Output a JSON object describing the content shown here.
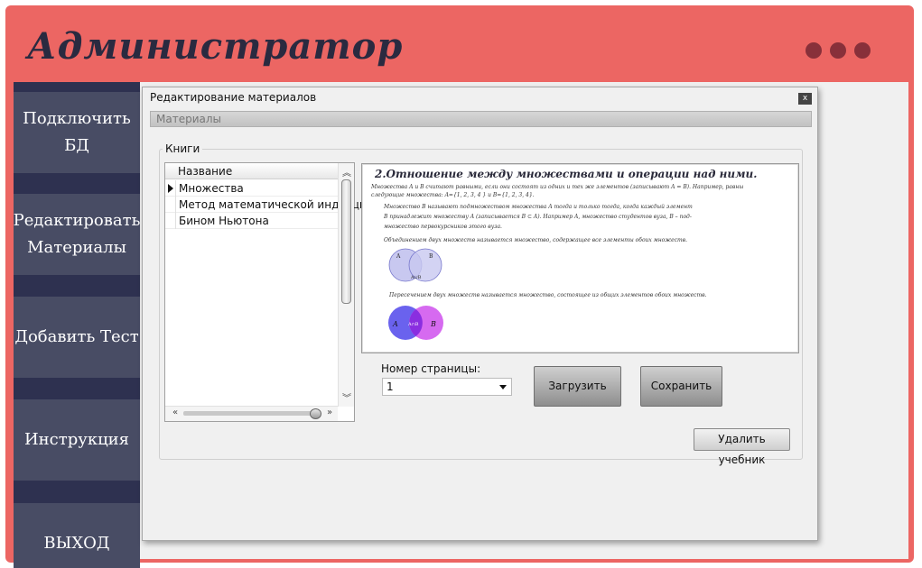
{
  "app": {
    "title": "Администратор"
  },
  "sidebar": {
    "items": [
      {
        "label": "Подключить БД"
      },
      {
        "label": "Редактировать Материалы"
      },
      {
        "label": "Добавить Тест"
      },
      {
        "label": "Инструкция"
      },
      {
        "label": "ВЫХОД"
      }
    ]
  },
  "dialog": {
    "title": "Редактирование материалов",
    "close_glyph": "x",
    "tab": "Материалы",
    "group_label": "Книги",
    "grid": {
      "column_header": "Название",
      "rows": [
        "Множества",
        "Метод математической индукции",
        "Бином Ньютона"
      ],
      "selected_index": 0
    },
    "page_preview": {
      "heading": "2.Отношение между множествами и операции над ними.",
      "lines": [
        "Множества A и B считают равными, если они состоят из одних и тех же элементов (записывают A = B). Например, равны",
        "следующие множества: A={1, 2, 3, 4 } и B={1, 2, 3, 4}.",
        "Множество B называют подмножеством множества A тогда и только тогда, когда каждый элемент",
        "B принадлежит множеству A (записывается B ⊂ A). Например A, множество студентов вуза, B – под-",
        "множество первокурсников этого вуза.",
        "Объединением двух множеств называется множество, содержащее все элементы обоих множеств.",
        "Пересечением двух множеств называется множество, состоящее из общих элементов обоих множеств."
      ],
      "venn_union_labels": [
        "A",
        "B",
        "A∪B"
      ],
      "venn_intersection_labels": [
        "A",
        "A∩B",
        "B"
      ]
    },
    "page_number_label": "Номер страницы:",
    "page_number_value": "1",
    "load_button": "Загрузить",
    "save_button": "Сохранить",
    "delete_button": "Удалить учебник"
  },
  "colors": {
    "frame": "#ec6663",
    "sidebar": "#2e3150",
    "nav_button": "#484c64",
    "title_dots": "#88303a"
  }
}
